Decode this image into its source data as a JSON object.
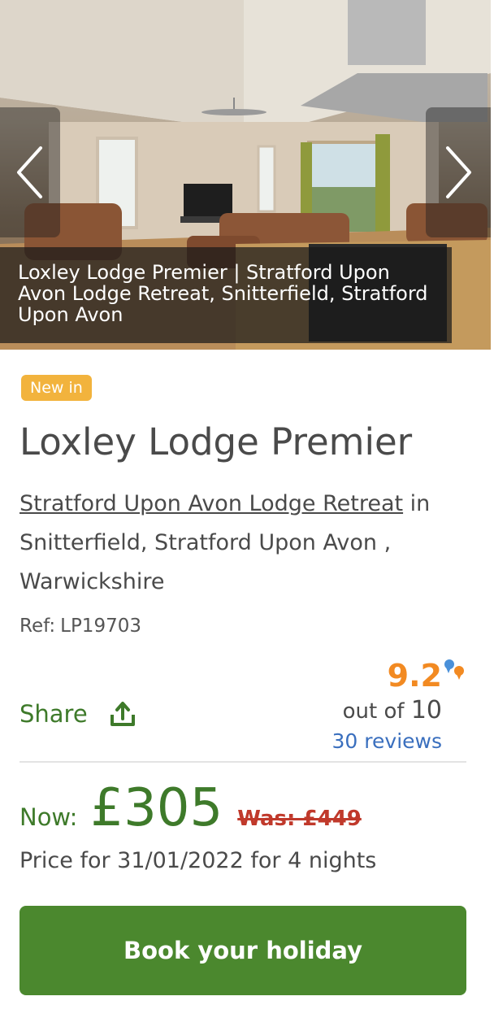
{
  "hero": {
    "caption": "Loxley Lodge Premier | Stratford Upon Avon Lodge Retreat, Snitterfield, Stratford Upon Avon",
    "prev_icon": "chevron-left-icon",
    "next_icon": "chevron-right-icon"
  },
  "property": {
    "badge": "New in",
    "title": "Loxley Lodge Premier",
    "park_link": "Stratford Upon Avon Lodge Retreat",
    "location_rest": " in Snitterfield, Stratford Upon Avon , Warwickshire",
    "ref_label": "Ref:",
    "ref_value": "LP19703"
  },
  "share": {
    "label": "Share",
    "icon": "share-upload-icon"
  },
  "rating": {
    "score": "9.2",
    "out_of_label": "out of",
    "out_of_value": "10",
    "reviews": "30 reviews"
  },
  "pricing": {
    "now_label": "Now:",
    "price": "£305",
    "was": "Was: £449",
    "note": "Price for 31/01/2022 for 4 nights"
  },
  "cta": {
    "book_label": "Book your holiday"
  },
  "colors": {
    "brand_green": "#4b882e",
    "text_green": "#3e7a2a",
    "badge_orange": "#f2b33d",
    "rating_orange": "#f28a22",
    "link_blue": "#3a6fbe",
    "was_red": "#c0392b"
  }
}
